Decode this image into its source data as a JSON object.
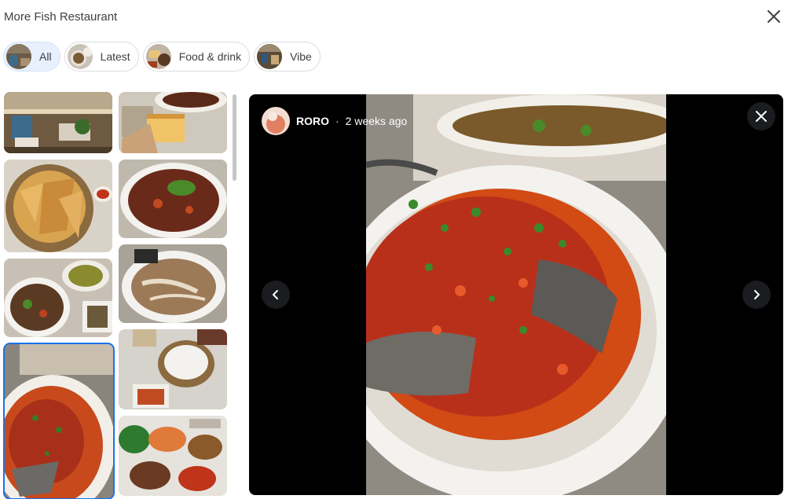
{
  "header": {
    "title": "More Fish Restaurant",
    "close_icon": "close-icon"
  },
  "filters": [
    {
      "label": "All",
      "active": true
    },
    {
      "label": "Latest",
      "active": false
    },
    {
      "label": "Food & drink",
      "active": false
    },
    {
      "label": "Vibe",
      "active": false
    }
  ],
  "gallery": {
    "selected_index": 6
  },
  "viewer": {
    "author": "RORO",
    "separator": "·",
    "posted": "2 weeks ago",
    "prev_icon": "chevron-left-icon",
    "next_icon": "chevron-right-icon",
    "close_icon": "close-icon"
  },
  "colors": {
    "accent": "#1a73e8",
    "active_chip_bg": "#e8f0fe",
    "viewer_bg": "#000000"
  }
}
